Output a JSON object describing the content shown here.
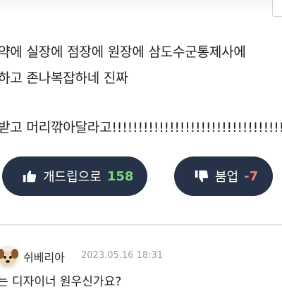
{
  "post": {
    "lines": [
      "약에 실장에 점장에 원장에 삼도수군통제사에",
      "하고 존나복잡하네 진짜",
      "받고 머리깎아달라고!!!!!!!!!!!!!!!!!!!!!!!!!!!!!!!!!!"
    ]
  },
  "votes": {
    "up": {
      "label": "개드립으로",
      "count": "158",
      "icon": "thumbs-up-icon",
      "count_color": "#7dd67a"
    },
    "down": {
      "label": "붐업",
      "count": "-7",
      "icon": "thumbs-down-icon",
      "count_color": "#f07a7a"
    }
  },
  "comment": {
    "author": "쉬베리아",
    "date": "2023.05.16 18:31",
    "text": "는 디자이너 원우신가요?",
    "avatar_icon": "dog-avatar-icon"
  },
  "colors": {
    "button_bg": "#253247",
    "divider": "#e3e6ea"
  }
}
